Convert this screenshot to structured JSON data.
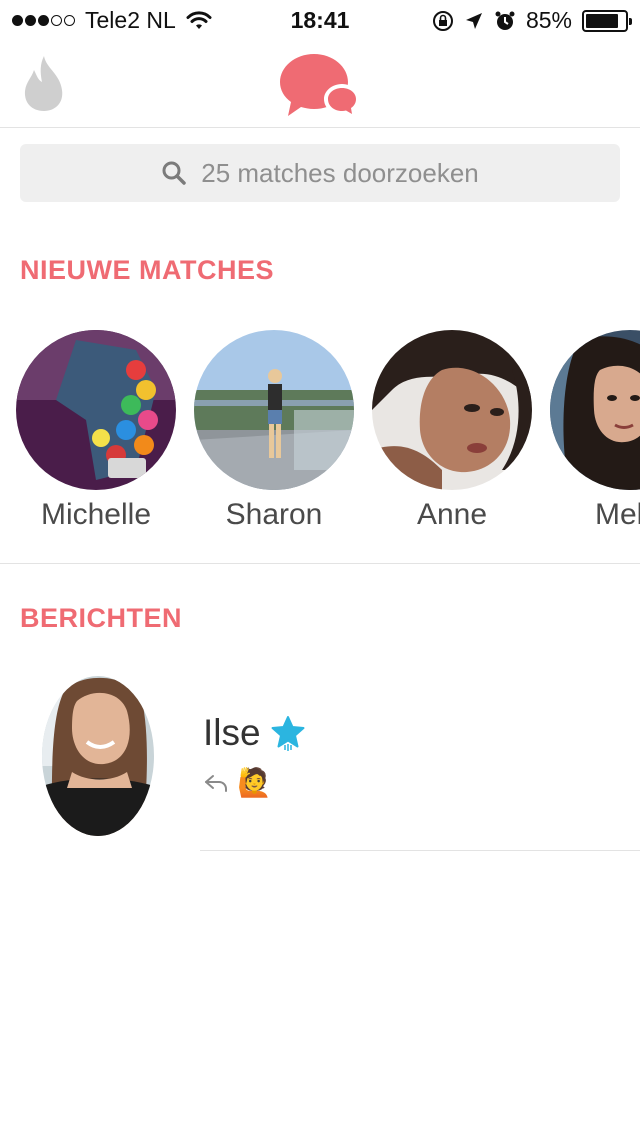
{
  "status_bar": {
    "carrier": "Tele2 NL",
    "time": "18:41",
    "battery_percent": "85%",
    "battery_level": 0.85,
    "signal_bars_filled": 3,
    "signal_bars_total": 5
  },
  "header": {
    "left_icon": "flame-icon",
    "center_icon": "chat-bubbles-icon",
    "accent_color": "#ef6b73"
  },
  "search": {
    "placeholder": "25 matches doorzoeken"
  },
  "new_matches": {
    "title": "NIEUWE MATCHES",
    "items": [
      {
        "name": "Michelle"
      },
      {
        "name": "Sharon"
      },
      {
        "name": "Anne"
      },
      {
        "name": "Melis"
      }
    ]
  },
  "messages": {
    "title": "BERICHTEN",
    "items": [
      {
        "name": "Ilse",
        "badge_icon": "blue-star-icon",
        "preview_icon": "reply-icon",
        "preview_emoji": "🙋"
      }
    ]
  }
}
